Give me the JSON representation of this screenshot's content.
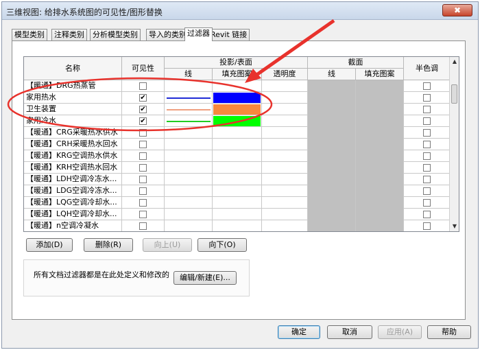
{
  "window": {
    "title": "三维视图: 给排水系统图的可见性/图形替换",
    "close_glyph": "✖"
  },
  "tabs": [
    {
      "label": "模型类别"
    },
    {
      "label": "注释类别"
    },
    {
      "label": "分析模型类别"
    },
    {
      "label": "导入的类别"
    },
    {
      "label": "过滤器"
    },
    {
      "label": "Revit 链接"
    }
  ],
  "active_tab_index": 4,
  "table": {
    "headers": {
      "name": "名称",
      "visibility": "可见性",
      "projection_group": "投影/表面",
      "proj_line": "线",
      "proj_fill": "填充图案",
      "transparency": "透明度",
      "cut_group": "截面",
      "cut_line": "线",
      "cut_fill": "填充图案",
      "halftone": "半色调"
    },
    "rows": [
      {
        "name": "【暖通】DRG热蒸管",
        "visible": false,
        "check": "",
        "line_color": "",
        "fill_color": ""
      },
      {
        "name": "家用热水",
        "visible": true,
        "check": "✔",
        "line_color": "#1f2bd6",
        "fill_color": "#0000ff"
      },
      {
        "name": "卫生装置",
        "visible": true,
        "check": "✔",
        "line_color": "#f0a080",
        "fill_color": "#f7883c"
      },
      {
        "name": "家用冷水",
        "visible": true,
        "check": "✔",
        "line_color": "#22cc22",
        "fill_color": "#00ff00"
      },
      {
        "name": "【暖通】CRG采暖热水供水",
        "visible": false,
        "check": "",
        "line_color": "",
        "fill_color": ""
      },
      {
        "name": "【暖通】CRH采暖热水回水",
        "visible": false,
        "check": "",
        "line_color": "",
        "fill_color": ""
      },
      {
        "name": "【暖通】KRG空调热水供水",
        "visible": false,
        "check": "",
        "line_color": "",
        "fill_color": ""
      },
      {
        "name": "【暖通】KRH空调热水回水",
        "visible": false,
        "check": "",
        "line_color": "",
        "fill_color": ""
      },
      {
        "name": "【暖通】LDH空调冷冻水...",
        "visible": false,
        "check": "",
        "line_color": "",
        "fill_color": ""
      },
      {
        "name": "【暖通】LDG空调冷冻水...",
        "visible": false,
        "check": "",
        "line_color": "",
        "fill_color": ""
      },
      {
        "name": "【暖通】LQG空调冷却水...",
        "visible": false,
        "check": "",
        "line_color": "",
        "fill_color": ""
      },
      {
        "name": "【暖通】LQH空调冷却水...",
        "visible": false,
        "check": "",
        "line_color": "",
        "fill_color": ""
      },
      {
        "name": "【暖通】n空调冷凝水",
        "visible": false,
        "check": "",
        "line_color": "",
        "fill_color": ""
      }
    ]
  },
  "row_buttons": {
    "add": "添加(D)",
    "delete": "删除(R)",
    "up": "向上(U)",
    "down": "向下(O)"
  },
  "info": {
    "text": "所有文档过滤器都是在此处定义和修改的",
    "edit_button": "编辑/新建(E)..."
  },
  "footer": {
    "ok": "确定",
    "cancel": "取消",
    "apply": "应用(A)",
    "help": "帮助"
  },
  "annotation": {
    "color": "#e8322c"
  },
  "scrollbar": {
    "up": "▲",
    "down": "▼"
  }
}
